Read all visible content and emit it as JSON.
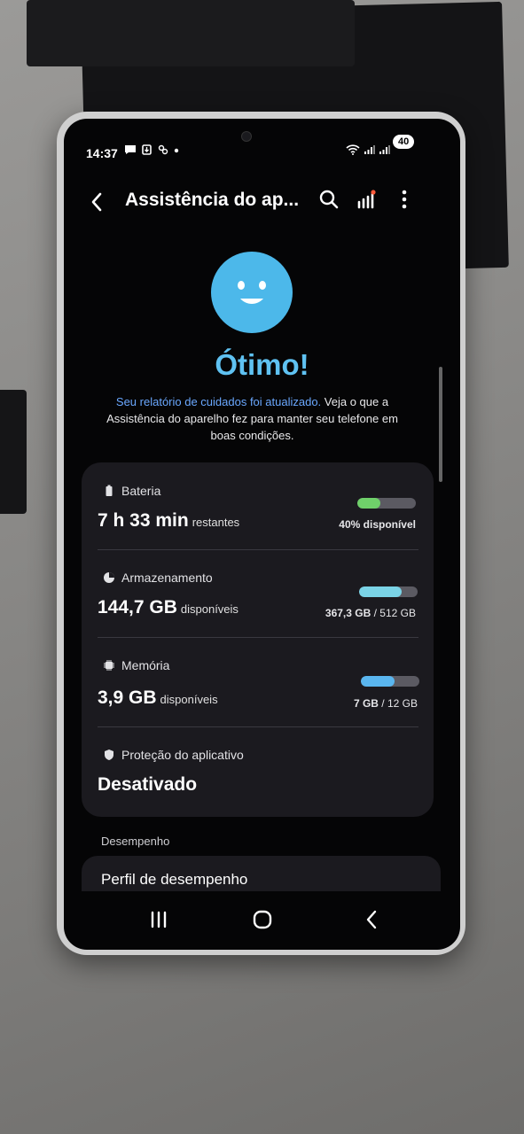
{
  "status_bar": {
    "time": "14:37",
    "battery_level": "40",
    "left_icons": [
      "message-icon",
      "download-icon",
      "vpn-icon",
      "dot-icon"
    ],
    "right_icons": [
      "wifi-icon",
      "signal-icon",
      "signal-icon"
    ]
  },
  "header": {
    "title": "Assistência do ap...",
    "icons": [
      "back-icon",
      "search-icon",
      "signal-bars-icon",
      "more-icon"
    ]
  },
  "status": {
    "title": "Ótimo!",
    "report_link": "Seu relatório de cuidados foi atualizado.",
    "report_text": " Veja o que a Assistência do aparelho fez para manter seu telefone em boas condições."
  },
  "battery": {
    "label": "Bateria",
    "value": "7 h 33 min",
    "unit": "restantes",
    "detail": "40% disponível",
    "level": 0.4,
    "color": "#6fd06a"
  },
  "storage": {
    "label": "Armazenamento",
    "value": "144,7 GB",
    "unit": "disponíveis",
    "used": "367,3 GB",
    "sep": " / ",
    "total": "512 GB",
    "level": 0.72,
    "color": "#7ad3e6"
  },
  "memory": {
    "label": "Memória",
    "value": "3,9 GB",
    "unit": "disponíveis",
    "used": "7 GB",
    "sep": " / ",
    "total": "12 GB",
    "level": 0.58,
    "color": "#5ab6ef"
  },
  "protection": {
    "label": "Proteção do aplicativo",
    "value": "Desativado"
  },
  "performance": {
    "header": "Desempenho",
    "item": "Perfil de desempenho"
  }
}
